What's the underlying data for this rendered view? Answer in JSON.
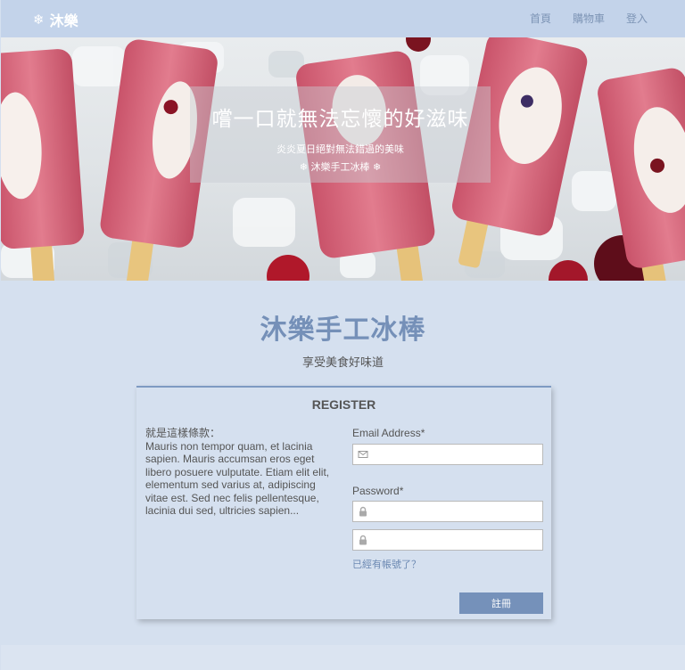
{
  "navbar": {
    "brand_icon": "❄",
    "brand_name": "沐樂",
    "links": [
      "首頁",
      "購物車",
      "登入"
    ]
  },
  "hero": {
    "title": "嚐一口就無法忘懷的好滋味",
    "subtitle": "炎炎夏日絕對無法錯過的美味",
    "tagline": "❄ 沐樂手工冰棒 ❄"
  },
  "main": {
    "title": "沐樂手工冰棒",
    "subtitle": "享受美食好味道"
  },
  "register": {
    "title": "REGISTER",
    "terms_heading": "就是這樣條款：",
    "terms_body": "Mauris non tempor quam, et lacinia sapien. Mauris accumsan eros eget libero posuere vulputate. Etiam elit elit, elementum sed varius at, adipiscing vitae est. Sed nec felis pellentesque, lacinia dui sed, ultricies sapien...",
    "email_label": "Email Address*",
    "email_value": "",
    "email_icon": "envelope-icon",
    "password_label": "Password*",
    "password_value": "",
    "confirm_value": "",
    "lock_icon": "lock-icon",
    "login_link": "已經有帳號了？",
    "submit_label": "註冊"
  },
  "colors": {
    "background": "#d5e0ef",
    "navbar": "#c3d3ea",
    "accent": "#7590b8",
    "button": "#7591ba"
  }
}
